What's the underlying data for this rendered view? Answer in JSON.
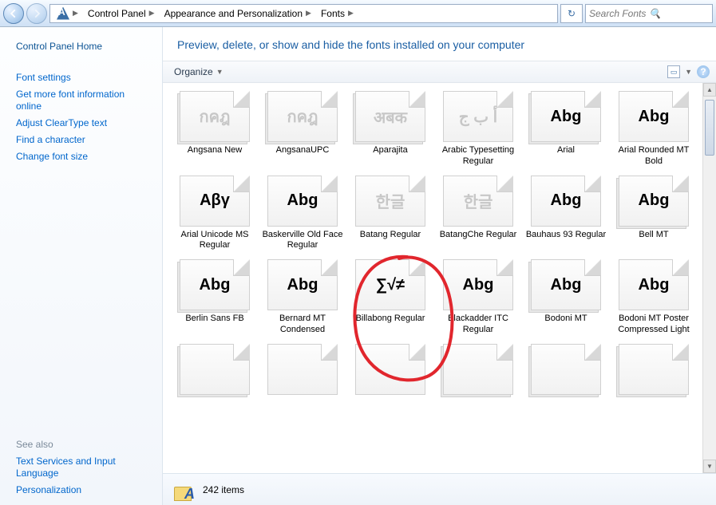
{
  "breadcrumb": {
    "seg1": "Control Panel",
    "seg2": "Appearance and Personalization",
    "seg3": "Fonts"
  },
  "search": {
    "placeholder": "Search Fonts"
  },
  "sidebar": {
    "home": "Control Panel Home",
    "links": [
      "Font settings",
      "Get more font information online",
      "Adjust ClearType text",
      "Find a character",
      "Change font size"
    ],
    "seealso_label": "See also",
    "seealso": [
      "Text Services and Input Language",
      "Personalization"
    ]
  },
  "page": {
    "heading": "Preview, delete, or show and hide the fonts installed on your computer"
  },
  "toolbar": {
    "organize": "Organize"
  },
  "fonts": [
    {
      "name": "Angsana New",
      "sample": "กคฎ",
      "stack": true,
      "dim": true
    },
    {
      "name": "AngsanaUPC",
      "sample": "กคฎ",
      "stack": true,
      "dim": true
    },
    {
      "name": "Aparajita",
      "sample": "अबक",
      "stack": true,
      "dim": true
    },
    {
      "name": "Arabic Typesetting Regular",
      "sample": "أ ب ج",
      "stack": false,
      "dim": true
    },
    {
      "name": "Arial",
      "sample": "Abg",
      "stack": true,
      "dim": false
    },
    {
      "name": "Arial Rounded MT Bold",
      "sample": "Abg",
      "stack": false,
      "dim": false
    },
    {
      "name": "Arial Unicode MS Regular",
      "sample": "Αβγ",
      "stack": false,
      "dim": false
    },
    {
      "name": "Baskerville Old Face Regular",
      "sample": "Abg",
      "stack": false,
      "dim": false
    },
    {
      "name": "Batang Regular",
      "sample": "한글",
      "stack": false,
      "dim": true
    },
    {
      "name": "BatangChe Regular",
      "sample": "한글",
      "stack": false,
      "dim": true
    },
    {
      "name": "Bauhaus 93 Regular",
      "sample": "Abg",
      "stack": false,
      "dim": false
    },
    {
      "name": "Bell MT",
      "sample": "Abg",
      "stack": true,
      "dim": false
    },
    {
      "name": "Berlin Sans FB",
      "sample": "Abg",
      "stack": true,
      "dim": false
    },
    {
      "name": "Bernard MT Condensed",
      "sample": "Abg",
      "stack": false,
      "dim": false
    },
    {
      "name": "Billabong Regular",
      "sample": "∑√≠",
      "stack": false,
      "dim": false
    },
    {
      "name": "Blackadder ITC Regular",
      "sample": "Abg",
      "stack": false,
      "dim": false
    },
    {
      "name": "Bodoni MT",
      "sample": "Abg",
      "stack": true,
      "dim": false
    },
    {
      "name": "Bodoni MT Poster Compressed Light",
      "sample": "Abg",
      "stack": false,
      "dim": false
    },
    {
      "name": "",
      "sample": "",
      "stack": true,
      "dim": false
    },
    {
      "name": "",
      "sample": "",
      "stack": false,
      "dim": false
    },
    {
      "name": "",
      "sample": "",
      "stack": false,
      "dim": false
    },
    {
      "name": "",
      "sample": "",
      "stack": true,
      "dim": false
    },
    {
      "name": "",
      "sample": "",
      "stack": true,
      "dim": false
    },
    {
      "name": "",
      "sample": "",
      "stack": true,
      "dim": false
    }
  ],
  "status": {
    "count": "242 items"
  },
  "annotation": {
    "circled_font": "Billabong Regular"
  }
}
